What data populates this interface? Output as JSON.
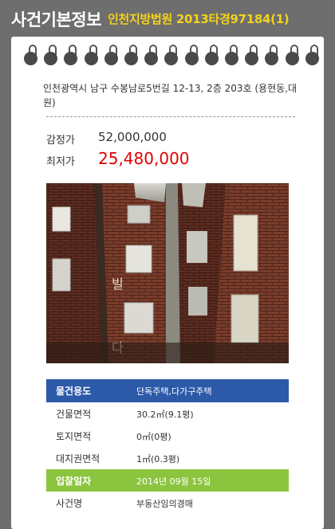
{
  "header": {
    "title": "사건기본정보",
    "subtitle": "인천지방법원 2013타경97184(1)"
  },
  "property": {
    "address": "인천광역시 남구 수봉남로5번길 12-13, 2층 203호 (용현동,대원)",
    "appraisal_label": "감정가",
    "appraisal_value": "52,000,000",
    "minimum_label": "최저가",
    "minimum_value": "25,480,000",
    "photo_alt": "건물 사진"
  },
  "details": [
    {
      "label": "물건용도",
      "value": "단독주택,다가구주택",
      "style": "blue"
    },
    {
      "label": "건물면적",
      "value": "30.2㎡(9.1평)",
      "style": "plain"
    },
    {
      "label": "토지면적",
      "value": "0㎡(0평)",
      "style": "plain"
    },
    {
      "label": "대지권면적",
      "value": "1㎡(0.3평)",
      "style": "plain"
    },
    {
      "label": "입찰일자",
      "value": "2014년 09월 15일",
      "style": "green"
    },
    {
      "label": "사건명",
      "value": "부동산임의경매",
      "style": "plain"
    }
  ],
  "colors": {
    "header_bg": "#6e6e6e",
    "title_text": "#ffffff",
    "subtitle_text": "#f2d21b",
    "min_price": "#e00000",
    "blue_row": "#2c5aa8",
    "green_row": "#8bc53f"
  },
  "binder_ring_count": 15
}
